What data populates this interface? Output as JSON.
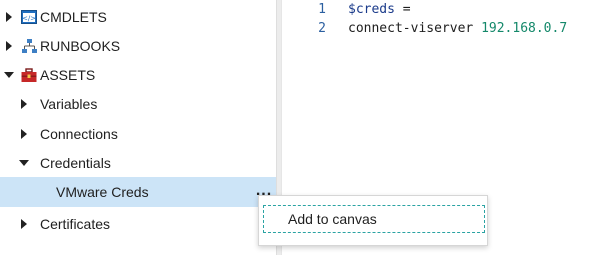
{
  "tree": {
    "items": [
      {
        "label": "CMDLETS",
        "expanded": false,
        "icon": "cmdlet-icon"
      },
      {
        "label": "RUNBOOKS",
        "expanded": false,
        "icon": "runbook-hierarchy-icon"
      },
      {
        "label": "ASSETS",
        "expanded": true,
        "icon": "toolbox-icon"
      }
    ],
    "assets_children": [
      {
        "label": "Variables",
        "expanded": false
      },
      {
        "label": "Connections",
        "expanded": false
      },
      {
        "label": "Credentials",
        "expanded": true
      },
      {
        "label": "Certificates",
        "expanded": false
      }
    ],
    "selected_credential": {
      "label": "VMware Creds",
      "more_label": "..."
    }
  },
  "context_menu": {
    "items": [
      {
        "label": "Add to canvas"
      }
    ]
  },
  "editor": {
    "lines": [
      {
        "number": "1",
        "var": "$creds",
        "rest": " ="
      },
      {
        "number": "2",
        "cmd": "connect-viserver ",
        "ip": "192.168.0.7"
      }
    ]
  },
  "colors": {
    "selection": "#cce4f7",
    "line_number": "#2b5fa0",
    "variable": "#1a3a8a",
    "ip_literal": "#14886a",
    "menu_focus_border": "#2aa3a3"
  }
}
